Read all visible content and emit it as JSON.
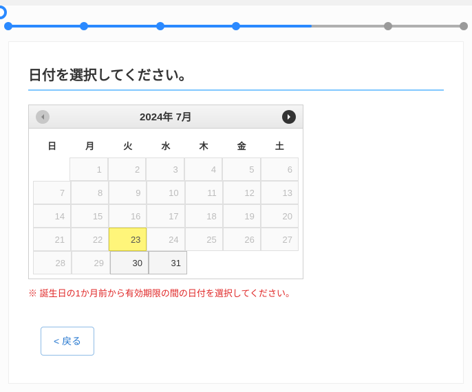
{
  "progress": {
    "total_steps": 7,
    "current_step": 5
  },
  "title": "日付を選択してください。",
  "calendar": {
    "month_label": "2024年 7月",
    "dow": [
      "日",
      "月",
      "火",
      "水",
      "木",
      "金",
      "土"
    ],
    "weeks": [
      [
        null,
        "1",
        "2",
        "3",
        "4",
        "5",
        "6"
      ],
      [
        "7",
        "8",
        "9",
        "10",
        "11",
        "12",
        "13"
      ],
      [
        "14",
        "15",
        "16",
        "17",
        "18",
        "19",
        "20"
      ],
      [
        "21",
        "22",
        "23",
        "24",
        "25",
        "26",
        "27"
      ],
      [
        "28",
        "29",
        "30",
        "31",
        null,
        null,
        null
      ]
    ],
    "today": "23",
    "selectable": [
      "30",
      "31"
    ]
  },
  "note": "※ 誕生日の1か月前から有効期限の間の日付を選択してください。",
  "back_label": "< 戻る"
}
